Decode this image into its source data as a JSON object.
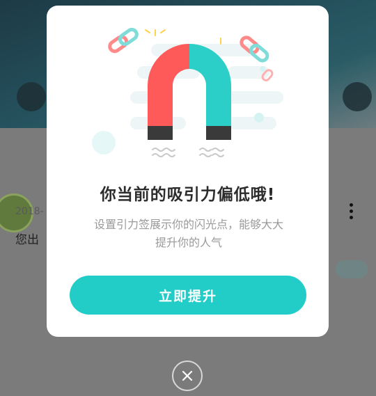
{
  "background": {
    "post_date": "2018-",
    "post_text": "您出"
  },
  "modal": {
    "title": "你当前的吸引力偏低哦!",
    "description_line1": "设置引力签展示你的闪光点，能够大大",
    "description_line2": "提升你的人气",
    "cta_label": "立即提升"
  },
  "colors": {
    "accent": "#22cdc7",
    "magnet_red": "#ff5a5a",
    "magnet_teal": "#2ccfc8"
  },
  "icons": {
    "illustration": "magnet-icon",
    "close": "close-icon"
  }
}
